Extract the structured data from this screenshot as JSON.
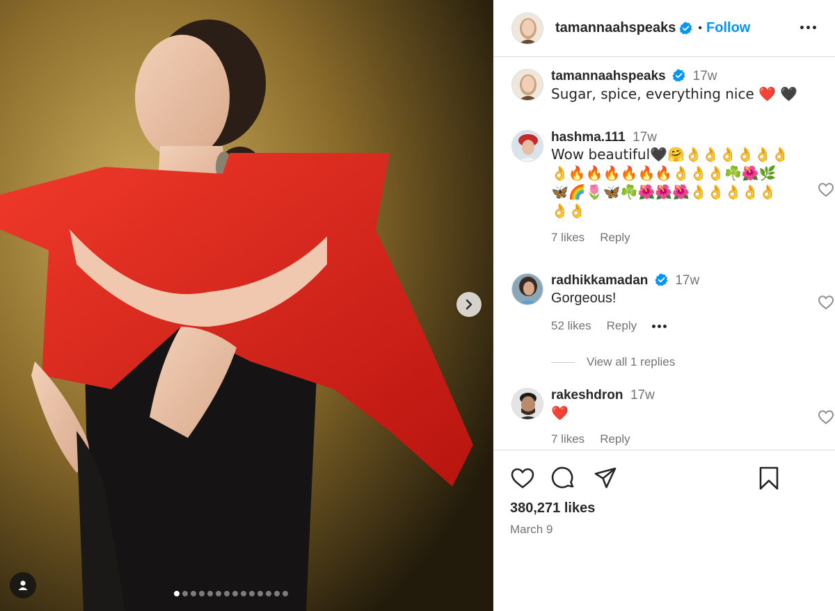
{
  "post": {
    "author": "tamannaahspeaks",
    "follow_label": "Follow",
    "separator": "•",
    "likes": "380,271 likes",
    "date": "March 9",
    "carousel_count": 14,
    "carousel_active": 0
  },
  "caption": {
    "username": "tamannaahspeaks",
    "time": "17w",
    "text": "Sugar, spice, everything nice ❤️ 🖤"
  },
  "comments": [
    {
      "username": "hashma.111",
      "time": "17w",
      "text": "Wow beautiful🖤🤗👌👌👌👌👌👌👌🔥🔥🔥🔥🔥🔥👌👌👌☘️🌺🌿🦋🌈🌷🦋☘️🌺🌺🌺👌👌👌👌👌👌👌",
      "likes": "7 likes",
      "reply": "Reply"
    },
    {
      "username": "radhikkamadan",
      "time": "17w",
      "text": "Gorgeous!",
      "likes": "52 likes",
      "reply": "Reply",
      "view_replies": "View all 1 replies"
    },
    {
      "username": "rakeshdron",
      "time": "17w",
      "text": "❤️",
      "likes": "7 likes",
      "reply": "Reply"
    }
  ],
  "icons": {
    "like": "heart-icon",
    "comment": "comment-icon",
    "share": "share-icon",
    "save": "bookmark-icon",
    "more": "more-icon",
    "next": "chevron-right-icon",
    "tag": "user-tag-icon",
    "verified": "verified-badge-icon"
  },
  "colors": {
    "accent": "#0095f6",
    "verified": "#0095f6",
    "text": "#262626",
    "muted": "#737373",
    "dress_red": "#e0261f"
  }
}
